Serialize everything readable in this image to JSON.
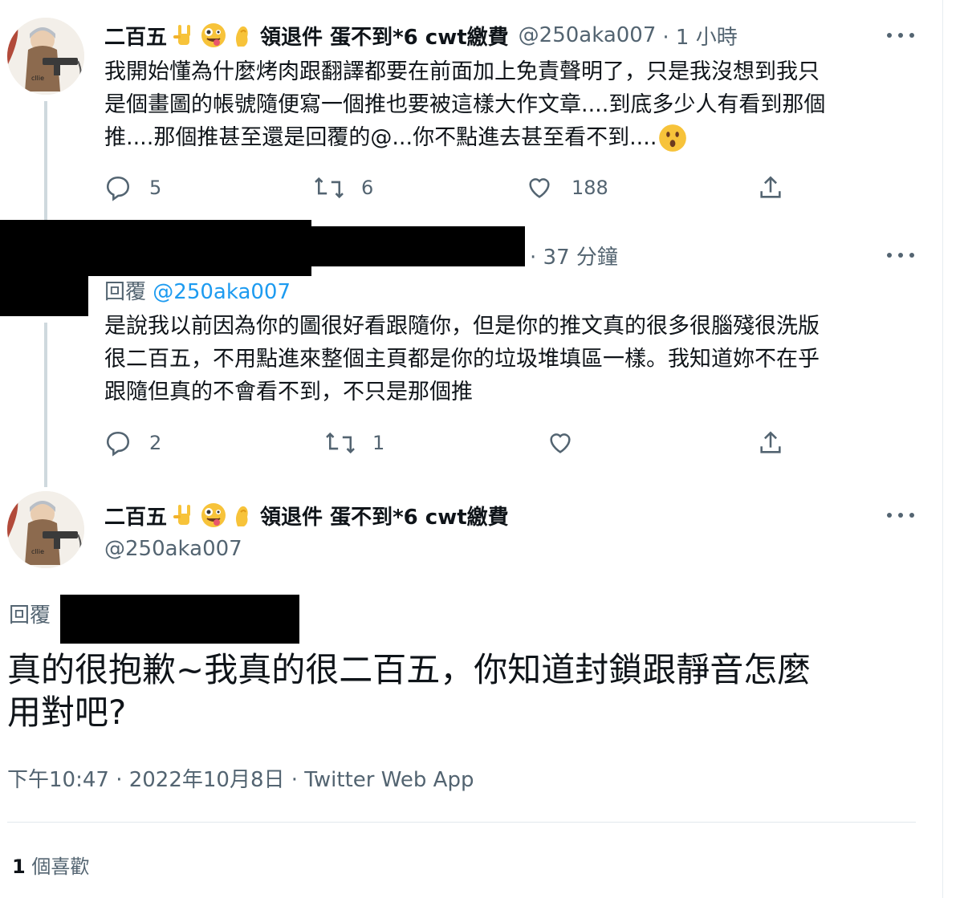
{
  "tweet1": {
    "display_name": "二百五",
    "name_suffix": "領退件 蛋不到*6 cwt繳費",
    "name_emojis": [
      "sign-of-horns-icon",
      "zany-face-icon",
      "pinching-hand-icon"
    ],
    "handle": "@250aka007",
    "time": "· 1 小時",
    "line1": "我開始懂為什麼烤肉跟翻譯都要在前面加上免責聲明了，只是我沒想到我只",
    "line2": "是個畫圖的帳號隨便寫一個推也要被這樣大作文章....到底多少人有看到那個",
    "line3": "推....那個推甚至還是回覆的@...你不點進去甚至看不到....",
    "trailing_emoji": "hushed-face-icon",
    "replies": "5",
    "retweets": "6",
    "likes": "188"
  },
  "tweet2": {
    "time": "· 37 分鐘",
    "replying_label": "回覆",
    "replying_to": "@250aka007",
    "line1": "是說我以前因為你的圖很好看跟隨你，但是你的推文真的很多很腦殘很洗版",
    "line2": "很二百五，不用點進來整個主頁都是你的垃圾堆填區一樣。我知道妳不在乎",
    "line3": "跟隨但真的不會看不到，不只是那個推",
    "replies": "2",
    "retweets": "1",
    "likes": ""
  },
  "main_tweet": {
    "display_name": "二百五",
    "name_suffix": "領退件 蛋不到*6 cwt繳費",
    "handle": "@250aka007",
    "replying_label": "回覆",
    "line1": "真的很抱歉~我真的很二百五，你知道封鎖跟靜音怎麼",
    "line2": "用對吧?",
    "timestamp": "下午10:47 · 2022年10月8日 · Twitter Web App",
    "like_count": "1",
    "like_label": "個喜歡"
  },
  "colors": {
    "text": "#0f1419",
    "secondary": "#536471",
    "link": "#1d9bf0",
    "thread_line": "#cfd9de"
  }
}
